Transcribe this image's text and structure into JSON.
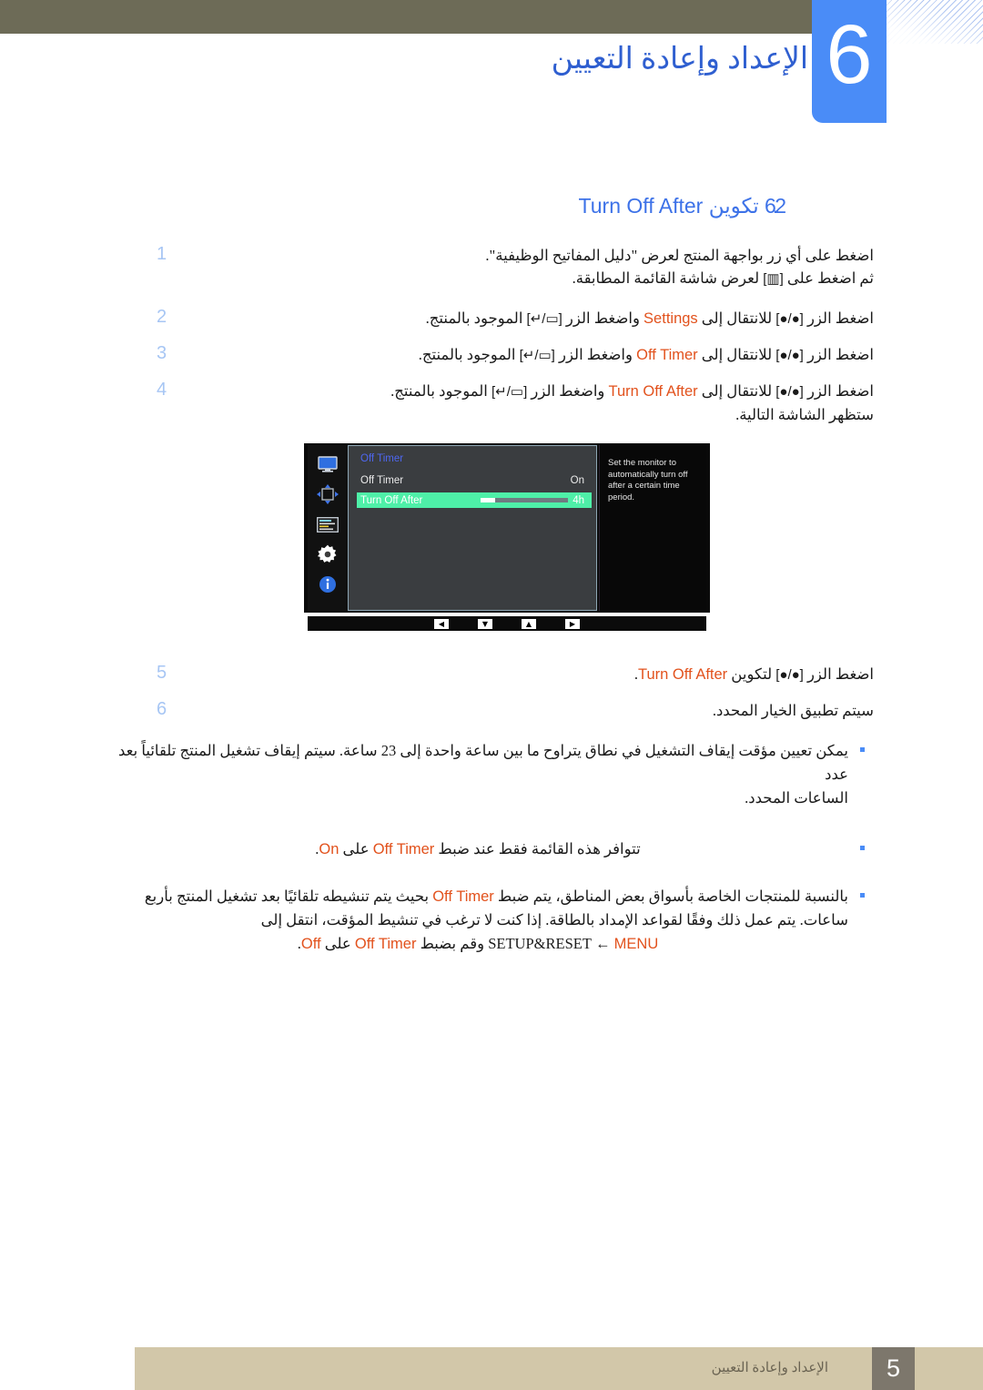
{
  "page": {
    "chapter_number": "6",
    "chapter_title": "الإعداد وإعادة التعيين",
    "footer_page_number": "5",
    "footer_chapter_title": "الإعداد وإعادة التعيين",
    "accent_blue": "#4a8cf7",
    "heading_blue": "#3d72e8",
    "highlight_orange": "#e2521d",
    "olive_bar": "#6d6b57",
    "footer_tan": "#d2c7a9"
  },
  "section": {
    "number": "6.2",
    "label_ar": "تكوين",
    "label_en": "Turn Off After"
  },
  "steps": [
    {
      "num": "1",
      "lines": [
        "اضغط على أي زر بواجهة المنتج لعرض \"دليل المفاتيح الوظيفية\".",
        "ثم اضغط على [▥] لعرض شاشة القائمة المطابقة."
      ]
    },
    {
      "num": "2",
      "lines": [
        "اضغط الزر [●/●] للانتقال إلى Settings واضغط الزر [↵/▭] الموجود بالمنتج."
      ],
      "target": "Settings"
    },
    {
      "num": "3",
      "lines": [
        "اضغط الزر [●/●] للانتقال إلى Off Timer واضغط الزر [↵/▭] الموجود بالمنتج."
      ],
      "target": "Off Timer"
    },
    {
      "num": "4",
      "lines": [
        "اضغط الزر [●/●] للانتقال إلى Turn Off After واضغط الزر [↵/▭] الموجود بالمنتج.",
        "ستظهر الشاشة التالية."
      ],
      "target": "Turn Off After"
    }
  ],
  "steps_after": [
    {
      "num": "5",
      "lines": [
        "اضغط الزر [●/●] لتكوين Turn Off After."
      ],
      "target": "Turn Off After"
    },
    {
      "num": "6",
      "lines": [
        "سيتم تطبيق الخيار المحدد."
      ]
    }
  ],
  "osd": {
    "menu_title": "Off Timer",
    "rows": [
      {
        "label": "Off Timer",
        "value": "On",
        "highlighted": false,
        "has_slider": false
      },
      {
        "label": "Turn Off After",
        "value": "4h",
        "highlighted": true,
        "has_slider": true,
        "slider_percent": 17
      }
    ],
    "description": "Set the monitor to automatically turn off after a certain time period.",
    "nav_buttons": [
      "◀",
      "▼",
      "▲",
      "▶"
    ],
    "sidebar_icons": [
      "monitor-icon",
      "dpad-icon",
      "picture-menu-icon",
      "gear-icon",
      "info-icon"
    ],
    "highlight_color": "#4ef0a8",
    "panel_color": "#3a3d40",
    "title_color": "#4e67f0"
  },
  "notes": [
    {
      "lines": [
        "يمكن تعيين مؤقت إيقاف التشغيل في نطاق يتراوح ما بين ساعة واحدة إلى 23 ساعة. سيتم إيقاف تشغيل المنتج تلقائياً بعد عدد",
        "الساعات المحدد."
      ]
    },
    {
      "lines": [
        "تتوافر هذه القائمة فقط عند ضبط Off Timer على On."
      ],
      "highlights": [
        "Off Timer",
        "On"
      ]
    },
    {
      "lines": [
        "بالنسبة للمنتجات الخاصة بأسواق بعض المناطق، يتم ضبط Off Timer بحيث يتم تنشيطه تلقائيًا بعد تشغيل المنتج بأربع",
        "ساعات. يتم عمل ذلك وفقًا لقواعد الإمداد بالطاقة. إذا كنت لا ترغب في تنشيط المؤقت، انتقل إلى",
        "MENU ← SETUP&RESET وقم بضبط Off Timer على Off."
      ],
      "highlights": [
        "Off Timer",
        "MENU",
        "SETUP&RESET",
        "Off"
      ]
    }
  ]
}
